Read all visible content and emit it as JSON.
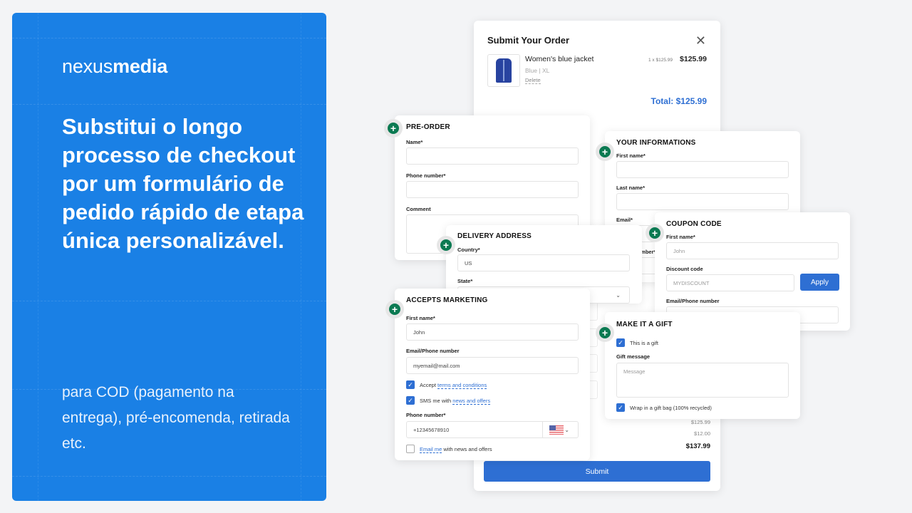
{
  "promo": {
    "logo_light": "nexus",
    "logo_bold": "media",
    "headline": "Substitui o longo processo de checkout por um formulário de pedido rápido de etapa única personalizável.",
    "subtext": "para COD (pagamento na entrega), pré-encomenda, retirada etc.",
    "background_color": "#1a80e5"
  },
  "order": {
    "title": "Submit Your Order",
    "close_icon": "close-icon",
    "item": {
      "name": "Women's blue jacket",
      "variant": "Blue  |  XL",
      "delete_label": "Delete",
      "quantity_price": "1 x $125.99",
      "price": "$125.99",
      "image": "blue-jacket-thumbnail"
    },
    "total": "Total: $125.99",
    "subtotal": "$125.99",
    "shipping": "$12.00",
    "grand_total": "$137.99",
    "submit_label": "Submit",
    "accent_color": "#2e6fd3"
  },
  "preorder": {
    "title": "PRE-ORDER",
    "fields": [
      {
        "label": "Name*",
        "value": ""
      },
      {
        "label": "Phone number*",
        "value": ""
      },
      {
        "label": "Comment",
        "value": ""
      }
    ]
  },
  "delivery": {
    "title": "DELIVERY ADDRESS",
    "country_label": "Country*",
    "country_value": "US",
    "state_label": "State*",
    "state_value": ""
  },
  "yourinfo": {
    "title": "YOUR INFORMATIONS",
    "fields": [
      {
        "label": "First name*",
        "value": ""
      },
      {
        "label": "Last name*",
        "value": ""
      },
      {
        "label": "Email*",
        "value": ""
      },
      {
        "label": "Phone number*",
        "value": ""
      }
    ]
  },
  "coupon": {
    "title": "COUPON CODE",
    "first_name_label": "First name*",
    "first_name_placeholder": "John",
    "discount_label": "Discount code",
    "discount_placeholder": "MYDISCOUNT",
    "apply_label": "Apply",
    "email_label": "Email/Phone number",
    "email_value": ""
  },
  "marketing": {
    "title": "ACCEPTS MARKETING",
    "first_name_label": "First name*",
    "first_name_value": "John",
    "email_label": "Email/Phone number",
    "email_value": "myemail@mail.com",
    "accept_prefix": "Accept",
    "accept_link": "terms and conditions",
    "accept_checked": true,
    "sms_prefix": "SMS me with",
    "sms_link": "news and offers",
    "sms_checked": true,
    "phone_label": "Phone number*",
    "phone_value": "+12345678910",
    "phone_country_flag": "us-flag-icon",
    "email_me_link": "Email me",
    "email_me_suffix": "with news and offers",
    "email_me_checked": false
  },
  "gift": {
    "title": "MAKE IT A GIFT",
    "is_gift_label": "This is a gift",
    "is_gift_checked": true,
    "message_label": "Gift message",
    "message_placeholder": "Message",
    "wrap_label": "Wrap in a gift bag (100% recycled)",
    "wrap_checked": true
  }
}
